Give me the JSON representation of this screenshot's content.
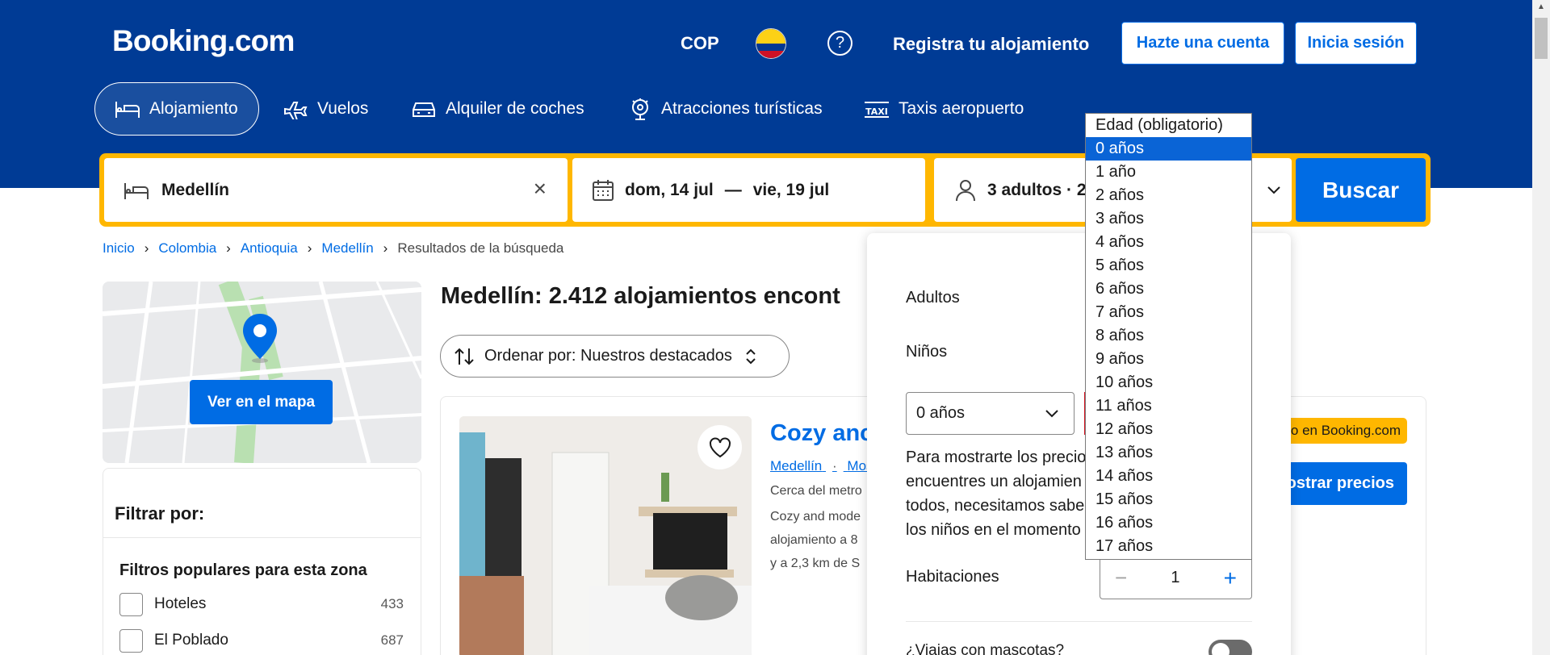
{
  "header": {
    "logo": "Booking.com",
    "currency": "COP",
    "help": "?",
    "list_property": "Registra tu alojamiento",
    "create_account": "Hazte una cuenta",
    "sign_in": "Inicia sesión"
  },
  "nav": [
    {
      "label": "Alojamiento",
      "icon": "bed-icon",
      "active": true
    },
    {
      "label": "Vuelos",
      "icon": "plane-icon"
    },
    {
      "label": "Alquiler de coches",
      "icon": "car-icon"
    },
    {
      "label": "Atracciones turísticas",
      "icon": "attractions-icon"
    },
    {
      "label": "Taxis aeropuerto",
      "icon": "taxi-icon"
    }
  ],
  "search": {
    "destination": "Medellín",
    "checkin": "dom, 14 jul",
    "separator": "—",
    "checkout": "vie, 19 jul",
    "guests": "3 adultos · 2",
    "button": "Buscar"
  },
  "breadcrumb": [
    "Inicio",
    "Colombia",
    "Antioquia",
    "Medellín",
    "Resultados de la búsqueda"
  ],
  "map": {
    "button": "Ver en el mapa"
  },
  "filters": {
    "title": "Filtrar por:",
    "section": "Filtros populares para esta zona",
    "items": [
      {
        "label": "Hoteles",
        "count": "433"
      },
      {
        "label": "El Poblado",
        "count": "687"
      }
    ]
  },
  "results": {
    "title": "Medellín: 2.412 alojamientos encont",
    "sort_label": "Ordenar por: Nuestros destacados"
  },
  "card": {
    "title": "Cozy anc",
    "loc_city": "Medellín",
    "loc_dot": "·",
    "loc_more": "Mos",
    "near": "Cerca del metro",
    "desc1": "Cozy and mode",
    "desc2": "alojamiento a 8",
    "desc3": "y a 2,3 km de S",
    "badge": "o en Booking.com",
    "price_button": "ostrar precios"
  },
  "guest_panel": {
    "adults_label": "Adultos",
    "children_label": "Niños",
    "child_age_value": "0 años",
    "info_line1": "Para mostrarte los precio",
    "info_line2": "encuentres un alojamien",
    "info_line3": "todos, necesitamos sabe",
    "info_line4": "los niños en el momento",
    "rooms_label": "Habitaciones",
    "rooms_value": "1",
    "pets_label": "¿Viajas con mascotas?"
  },
  "age_dropdown": {
    "header": "Edad (obligatorio)",
    "options": [
      "0 años",
      "1 año",
      "2 años",
      "3 años",
      "4 años",
      "5 años",
      "6 años",
      "7 años",
      "8 años",
      "9 años",
      "10 años",
      "11 años",
      "12 años",
      "13 años",
      "14 años",
      "15 años",
      "16 años",
      "17 años"
    ],
    "selected": "0 años"
  },
  "colors": {
    "brand_blue": "#003b95",
    "accent_blue": "#006ce4",
    "search_border": "#ffb700"
  }
}
